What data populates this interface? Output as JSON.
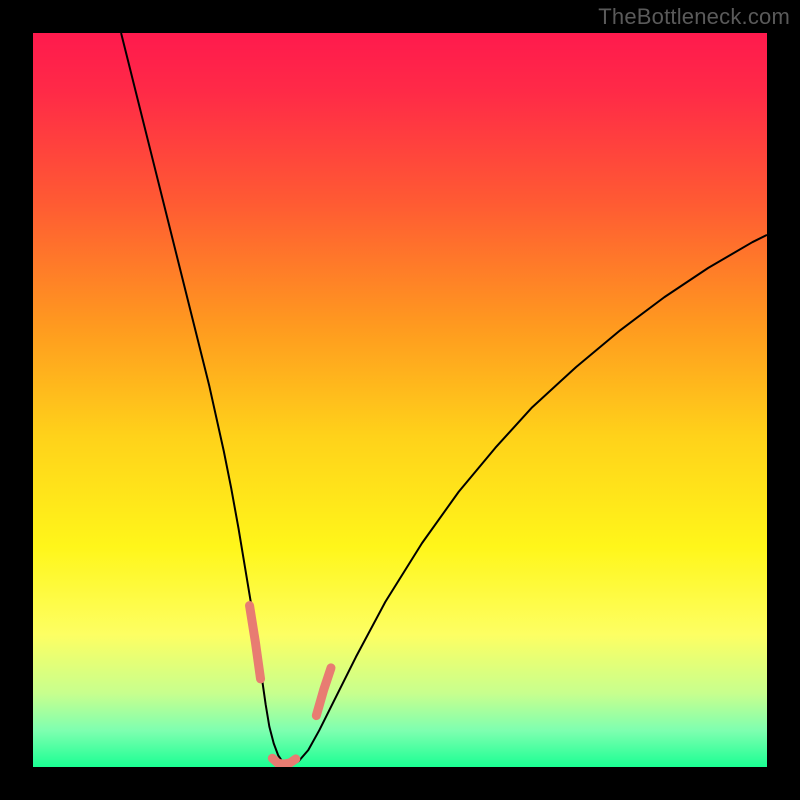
{
  "watermark": "TheBottleneck.com",
  "chart_data": {
    "type": "line",
    "title": "",
    "xlabel": "",
    "ylabel": "",
    "xlim": [
      0,
      100
    ],
    "ylim": [
      0,
      100
    ],
    "background_gradient": {
      "stops": [
        {
          "offset": 0.0,
          "color": "#ff1a4d"
        },
        {
          "offset": 0.08,
          "color": "#ff2a47"
        },
        {
          "offset": 0.23,
          "color": "#ff5a33"
        },
        {
          "offset": 0.4,
          "color": "#ff9a1f"
        },
        {
          "offset": 0.55,
          "color": "#ffd21a"
        },
        {
          "offset": 0.7,
          "color": "#fff61a"
        },
        {
          "offset": 0.82,
          "color": "#fdff63"
        },
        {
          "offset": 0.9,
          "color": "#c7ff8e"
        },
        {
          "offset": 0.95,
          "color": "#7fffb0"
        },
        {
          "offset": 1.0,
          "color": "#1aff93"
        }
      ]
    },
    "series": [
      {
        "name": "black-curve",
        "color": "#000000",
        "stroke_width": 2,
        "x": [
          12.0,
          14.0,
          16.0,
          18.0,
          20.0,
          22.0,
          24.0,
          26.0,
          27.0,
          28.0,
          29.0,
          30.0,
          30.6,
          31.2,
          31.7,
          32.2,
          32.8,
          33.4,
          34.0,
          34.6,
          35.3,
          36.2,
          37.5,
          39.0,
          41.0,
          44.0,
          48.0,
          53.0,
          58.0,
          63.0,
          68.0,
          74.0,
          80.0,
          86.0,
          92.0,
          98.0,
          100.0
        ],
        "y": [
          100.0,
          92.0,
          84.0,
          76.0,
          68.0,
          60.0,
          52.0,
          43.0,
          38.0,
          32.5,
          26.5,
          20.5,
          16.0,
          12.0,
          8.5,
          5.5,
          3.2,
          1.6,
          0.7,
          0.3,
          0.35,
          0.8,
          2.3,
          5.0,
          9.0,
          15.0,
          22.5,
          30.5,
          37.5,
          43.5,
          49.0,
          54.5,
          59.5,
          64.0,
          68.0,
          71.5,
          72.5
        ]
      },
      {
        "name": "salmon-overlay-left",
        "color": "#e87c72",
        "stroke_width": 9,
        "cap": "round",
        "x": [
          29.5,
          30.3,
          31.0
        ],
        "y": [
          22.0,
          17.0,
          12.0
        ]
      },
      {
        "name": "salmon-overlay-floor",
        "color": "#e87c72",
        "stroke_width": 9,
        "cap": "round",
        "x": [
          32.6,
          33.4,
          34.2,
          35.0,
          35.8
        ],
        "y": [
          1.2,
          0.5,
          0.4,
          0.55,
          1.1
        ]
      },
      {
        "name": "salmon-overlay-right",
        "color": "#e87c72",
        "stroke_width": 9,
        "cap": "round",
        "x": [
          38.6,
          39.6,
          40.6
        ],
        "y": [
          7.0,
          10.5,
          13.5
        ]
      }
    ]
  }
}
